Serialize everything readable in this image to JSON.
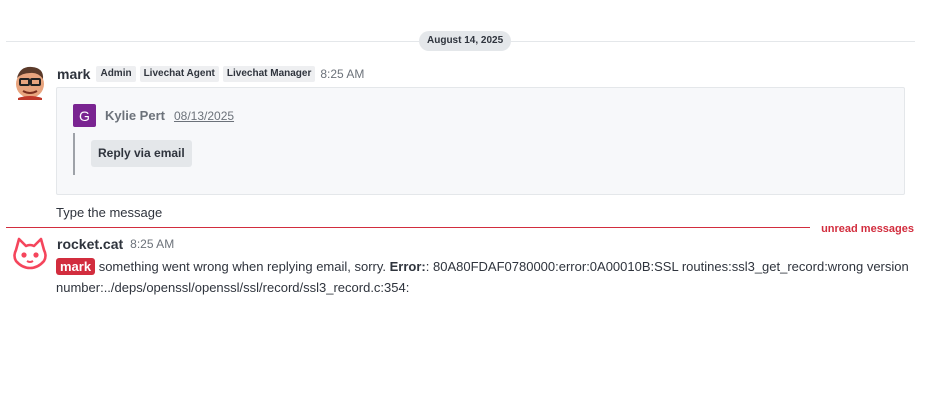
{
  "date_divider": "August 14, 2025",
  "message1": {
    "username": "mark",
    "roles": [
      "Admin",
      "Livechat Agent",
      "Livechat Manager"
    ],
    "time": "8:25 AM",
    "attachment": {
      "avatar_letter": "G",
      "author": "Kylie Pert",
      "date": "08/13/2025",
      "button": "Reply via email"
    },
    "text": "Type the message"
  },
  "unread_label": "unread messages",
  "message2": {
    "username": "rocket.cat",
    "time": "8:25 AM",
    "mention": "mark",
    "text_main": " something went wrong when replying email, sorry. ",
    "error_label": "Error:",
    "error_text": ": 80A80FDAF0780000:error:0A00010B:SSL routines:ssl3_get_record:wrong version number:../deps/openssl/openssl/ssl/record/ssl3_record.c:354:"
  },
  "colors": {
    "accent_red": "#d22d3e",
    "attachment_avatar": "#7a2491"
  }
}
